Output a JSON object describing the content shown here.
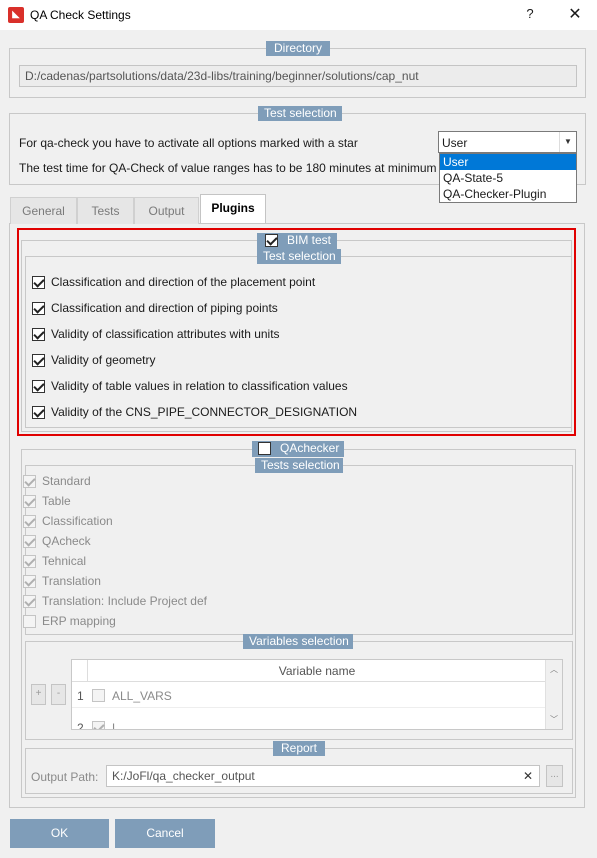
{
  "window": {
    "title": "QA Check Settings",
    "help_label": "?",
    "close_label": "✕"
  },
  "directory": {
    "group_label": "Directory",
    "path": "D:/cadenas/partsolutions/data/23d-libs/training/beginner/solutions/cap_nut"
  },
  "test_selection": {
    "group_label": "Test selection",
    "line1": "For qa-check you have to activate all options marked with a star",
    "line2": "The test time for QA-Check of value ranges has to be 180 minutes at minimum",
    "combo_value": "User",
    "dropdown_options": [
      "User",
      "QA-State-5",
      "QA-Checker-Plugin"
    ],
    "selected_option": "User"
  },
  "tabs": [
    "General",
    "Tests",
    "Output",
    "Plugins"
  ],
  "active_tab": "Plugins",
  "bim": {
    "header_label": "BIM test",
    "checked": true,
    "subgroup_label": "Test selection",
    "items": [
      {
        "label": "Classification and direction of the placement point",
        "checked": true
      },
      {
        "label": "Classification and direction of piping points",
        "checked": true
      },
      {
        "label": "Validity of classification attributes with units",
        "checked": true
      },
      {
        "label": "Validity of geometry",
        "checked": true
      },
      {
        "label": "Validity of table values in relation to classification values",
        "checked": true
      },
      {
        "label": "Validity of the CNS_PIPE_CONNECTOR_DESIGNATION",
        "checked": true
      }
    ]
  },
  "qachecker": {
    "header_label": "QAchecker",
    "checked": false,
    "tests_label": "Tests selection",
    "tests": [
      {
        "label": "Standard",
        "checked": true
      },
      {
        "label": "Table",
        "checked": true
      },
      {
        "label": "Classification",
        "checked": true
      },
      {
        "label": "QAcheck",
        "checked": true
      },
      {
        "label": "Tehnical",
        "checked": true
      },
      {
        "label": "Translation",
        "checked": true
      },
      {
        "label": "Translation: Include Project def",
        "checked": true
      },
      {
        "label": "ERP mapping",
        "checked": false
      }
    ],
    "variables": {
      "group_label": "Variables selection",
      "add_label": "+",
      "remove_label": "-",
      "column_header": "Variable name",
      "rows": [
        {
          "num": "1",
          "name": "ALL_VARS",
          "checked": false
        },
        {
          "num": "2",
          "name": "L",
          "checked": true
        }
      ]
    },
    "report": {
      "group_label": "Report",
      "output_label": "Output Path:",
      "output_path": "K:/JoFl/qa_checker_output",
      "clear_label": "✕",
      "browse_label": "..."
    }
  },
  "buttons": {
    "ok": "OK",
    "cancel": "Cancel"
  },
  "colors": {
    "group_label_bg": "#7f9db9",
    "highlight_border": "#e00000",
    "selection": "#0078d7"
  }
}
